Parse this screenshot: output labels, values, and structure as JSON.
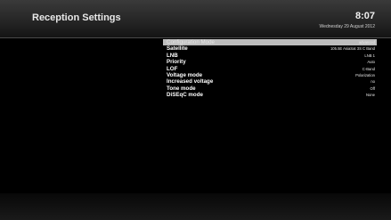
{
  "header": {
    "title": "Reception Settings",
    "time": "8:07",
    "date": "Wednesday 29 August 2012"
  },
  "menu": {
    "items": [
      {
        "label": "Configuration Mode",
        "value": "advanced",
        "selected": true
      },
      {
        "label": "Satellite",
        "value": "105.5E AsiaSat 3S C Band",
        "selected": false
      },
      {
        "label": "LNB",
        "value": "LNB 1",
        "selected": false
      },
      {
        "label": "Priority",
        "value": "Auto",
        "selected": false
      },
      {
        "label": "LOF",
        "value": "C-Band",
        "selected": false
      },
      {
        "label": "Voltage mode",
        "value": "Polarization",
        "selected": false
      },
      {
        "label": "Increased voltage",
        "value": "no",
        "selected": false
      },
      {
        "label": "Tone mode",
        "value": "Off",
        "selected": false
      },
      {
        "label": "DiSEqC mode",
        "value": "None",
        "selected": false
      }
    ]
  }
}
